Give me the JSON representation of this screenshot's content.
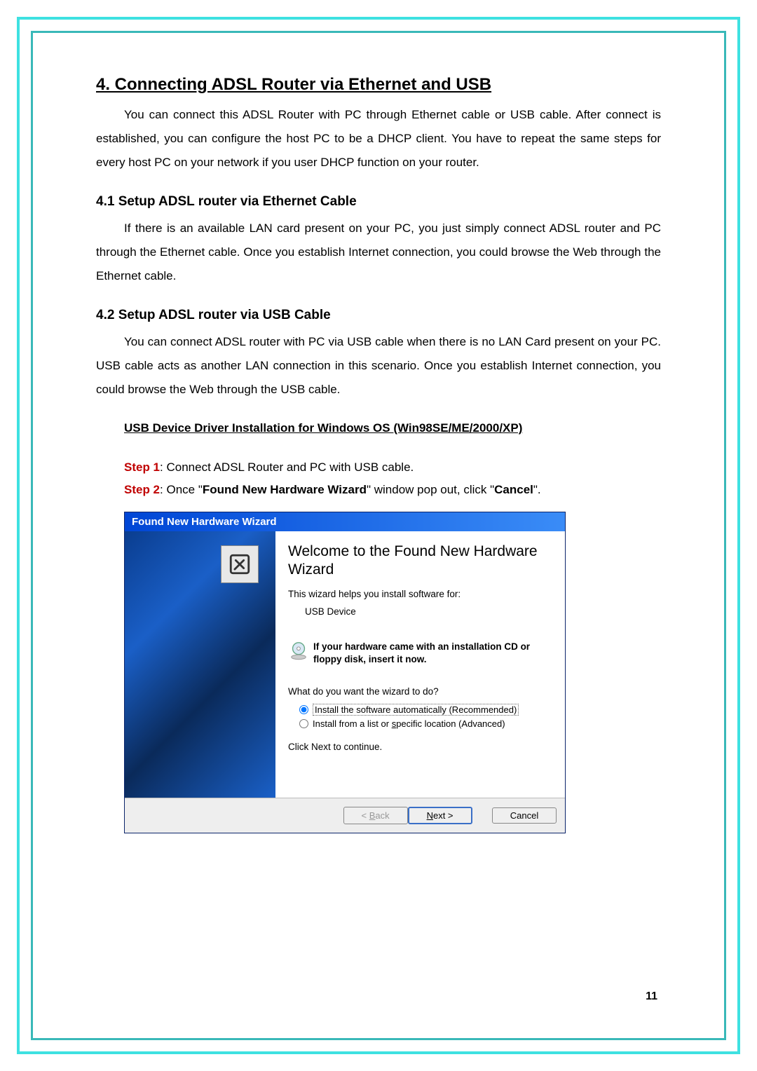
{
  "section": {
    "number_title": "4. Connecting ADSL Router via Ethernet and USB",
    "intro": "You can connect this ADSL Router with PC through Ethernet cable or USB cable. After connect is established, you can configure the host PC to be a DHCP client. You have to repeat the same steps for every host PC on your network if you user DHCP function on your router."
  },
  "sub41": {
    "heading": "4.1  Setup ADSL router via Ethernet Cable",
    "body": "If there is an available LAN card present on your PC, you just simply connect ADSL router and PC through the Ethernet cable. Once you establish Internet connection, you could browse the Web through the Ethernet cable."
  },
  "sub42": {
    "heading": "4.2  Setup ADSL router via USB Cable",
    "body": "You can connect ADSL router with PC via USB cable when there is no LAN Card present on your PC. USB cable acts as another LAN connection in this scenario. Once you establish Internet connection, you could browse the Web through the USB cable.",
    "usb_heading": "USB Device Driver Installation for Windows OS (Win98SE/ME/2000/XP)"
  },
  "steps": {
    "s1_label": "Step 1",
    "s1_text": ": Connect ADSL Router and PC with USB cable.",
    "s2_label": "Step 2",
    "s2_pre": ": Once \"",
    "s2_bold1": "Found New Hardware Wizard",
    "s2_mid": "\" window pop out, click \"",
    "s2_bold2": "Cancel",
    "s2_post": "\"."
  },
  "wizard": {
    "title": "Found New Hardware Wizard",
    "welcome": "Welcome to the Found New Hardware Wizard",
    "helps": "This wizard helps you install software for:",
    "device": "USB Device",
    "cd_line": "If your hardware came with an installation CD or floppy disk, insert it now.",
    "what": "What do you want the wizard to do?",
    "opt1": "Install the software automatically (Recommended)",
    "opt2": "Install from a list or specific location (Advanced)",
    "clicknext": "Click Next to continue.",
    "back": "< Back",
    "next": "Next >",
    "cancel": "Cancel"
  },
  "page_number": "11"
}
